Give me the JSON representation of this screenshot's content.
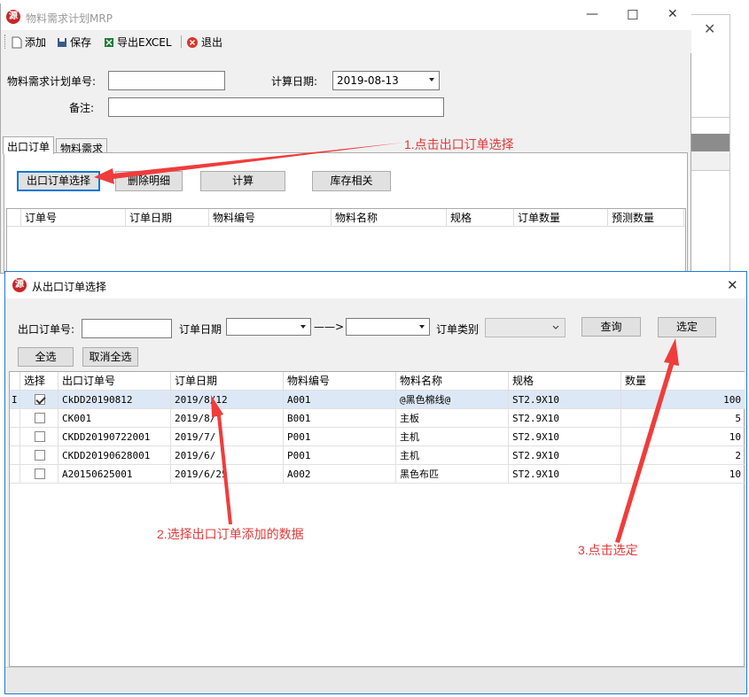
{
  "main_window": {
    "title": "物料需求计划MRP",
    "toolbar": {
      "add": "添加",
      "save": "保存",
      "export": "导出EXCEL",
      "exit": "退出"
    },
    "form": {
      "plan_no_label": "物料需求计划单号:",
      "plan_no_value": "",
      "calc_date_label": "计算日期:",
      "calc_date_value": "2019-08-13",
      "remark_label": "备注:",
      "remark_value": ""
    },
    "tabs": [
      "出口订单",
      "物料需求"
    ],
    "buttons": {
      "select_order": "出口订单选择",
      "delete_detail": "删除明细",
      "calculate": "计算",
      "inventory": "库存相关"
    },
    "grid_columns": [
      "订单号",
      "订单日期",
      "物料编号",
      "物料名称",
      "规格",
      "订单数量",
      "预测数量"
    ]
  },
  "dialog": {
    "title": "从出口订单选择",
    "filters": {
      "order_no_label": "出口订单号:",
      "order_no_value": "",
      "order_date_label": "订单日期",
      "range_arrow": "——>",
      "order_type_label": "订单类别",
      "query_button": "查询",
      "confirm_button": "选定",
      "select_all_button": "全选",
      "deselect_all_button": "取消全选"
    },
    "columns": [
      "选择",
      "出口订单号",
      "订单日期",
      "物料编号",
      "物料名称",
      "规格",
      "数量"
    ],
    "row_indicator": "I",
    "rows": [
      {
        "checked": true,
        "order_no": "CkDD20190812",
        "date": "2019/8/12",
        "item_code": "A001",
        "item_name": "@黑色棉线@",
        "spec": "ST2.9X10",
        "qty": "100"
      },
      {
        "checked": false,
        "order_no": "CK001",
        "date": "2019/8/",
        "item_code": "B001",
        "item_name": "主板",
        "spec": "ST2.9X10",
        "qty": "5"
      },
      {
        "checked": false,
        "order_no": "CKDD20190722001",
        "date": "2019/7/",
        "item_code": "P001",
        "item_name": "主机",
        "spec": "ST2.9X10",
        "qty": "10"
      },
      {
        "checked": false,
        "order_no": "CKDD20190628001",
        "date": "2019/6/",
        "item_code": "P001",
        "item_name": "主机",
        "spec": "ST2.9X10",
        "qty": "2"
      },
      {
        "checked": false,
        "order_no": "A20150625001",
        "date": "2019/6/25",
        "item_code": "A002",
        "item_name": "黑色布匹",
        "spec": "ST2.9X10",
        "qty": "10"
      }
    ]
  },
  "annotations": {
    "step1": "1.点击出口订单选择",
    "step2": "2.选择出口订单添加的数据",
    "step3": "3.点击选定"
  },
  "colors": {
    "annotation": "#e03a3a",
    "selected_row": "#dde8f6",
    "dialog_border": "#1c7cd5",
    "app_icon": "#c62828"
  }
}
